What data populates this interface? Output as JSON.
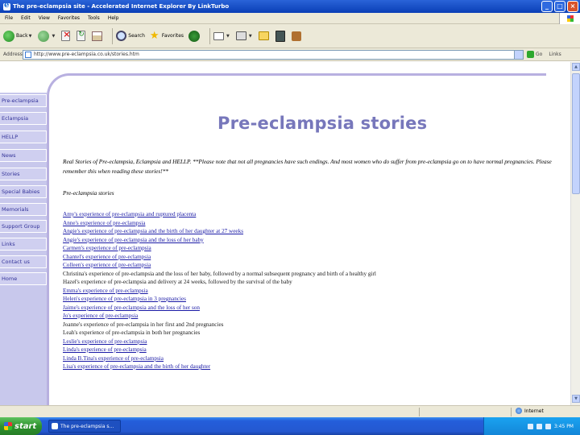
{
  "window": {
    "title": "The pre-eclampsia site - Accelerated Internet Explorer By LinkTurbo",
    "controls": {
      "minimize": "_",
      "maximize": "□",
      "close": "×"
    }
  },
  "menu": [
    "File",
    "Edit",
    "View",
    "Favorites",
    "Tools",
    "Help"
  ],
  "toolbar": {
    "back_label": "Back",
    "search_label": "Search",
    "favorites_label": "Favorites"
  },
  "address": {
    "label": "Address",
    "url": "http://www.pre-eclampsia.co.uk/stories.htm",
    "go_label": "Go",
    "links_label": "Links"
  },
  "sidebar": {
    "items": [
      {
        "label": "Pre-eclampsia"
      },
      {
        "label": "Eclampsia"
      },
      {
        "label": "HELLP"
      },
      {
        "label": "News"
      },
      {
        "label": "Stories"
      },
      {
        "label": "Special Babies"
      },
      {
        "label": "Memorials"
      },
      {
        "label": "Support Group"
      },
      {
        "label": "Links"
      },
      {
        "label": "Contact us"
      },
      {
        "label": "Home"
      }
    ]
  },
  "content": {
    "title": "Pre-eclampsia stories",
    "intro": "Real Stories of Pre-eclampsia, Eclampsia and HELLP. **Please note that not all pregnancies have such endings. And most women who do suffer from pre-eclampsia go on to have normal pregnancies. Please remember this when reading these stories!**",
    "subheading": "Pre-eclampsia stories",
    "stories": [
      {
        "text": "Amy's experience of pre-eclampsia and ruptured placenta",
        "link": true
      },
      {
        "text": "Anne's experience of pre-eclampsia",
        "link": true
      },
      {
        "text": "Angie's experience of pre-eclampsia and the birth of her daughter at 27 weeks",
        "link": true
      },
      {
        "text": "Angie's experience of pre-eclampsia and the loss of her baby",
        "link": true
      },
      {
        "text": "Carmen's experience of pre-eclampsia",
        "link": true
      },
      {
        "text": "Chantel's experience of pre-eclampsia",
        "link": true
      },
      {
        "text": "Colleen's experience of pre-eclampsia",
        "link": true
      },
      {
        "text": "Christina's experience of pre-eclampsia and the loss of her baby, followed by a normal subsequent pregnancy and birth of a healthy girl",
        "link": false
      },
      {
        "text": "Hazel's experience of pre-eclampsia and delivery at 24 weeks, followed by the survival of the baby",
        "link": false
      },
      {
        "text": "Emma's experience of pre-eclampsia",
        "link": true
      },
      {
        "text": "Helen's experience of pre-eclampsia in 3 pregnancies",
        "link": true
      },
      {
        "text": "Jaime's experience of pre-eclampsia and the loss of her son",
        "link": true
      },
      {
        "text": "Jo's experience of pre-eclampsia",
        "link": true
      },
      {
        "text": "Joanne's experience of pre-eclampsia in her first and 2nd pregnancies",
        "link": false
      },
      {
        "text": "Leah's experience of pre-eclampsia in both her pregnancies",
        "link": false
      },
      {
        "text": "Leslie's experience of pre-eclampsia",
        "link": true
      },
      {
        "text": "Linda's experience of pre-eclampsia",
        "link": true
      },
      {
        "text": "Linda B.Tina's experience of pre-eclampsia",
        "link": true
      },
      {
        "text": "Lisa's experience of pre-eclampsia and the birth of her daughter",
        "link": true
      }
    ]
  },
  "status": {
    "zone": "Internet"
  },
  "taskbar": {
    "start_label": "start",
    "task_label": "The pre-eclampsia s...",
    "clock": "3:45 PM"
  }
}
